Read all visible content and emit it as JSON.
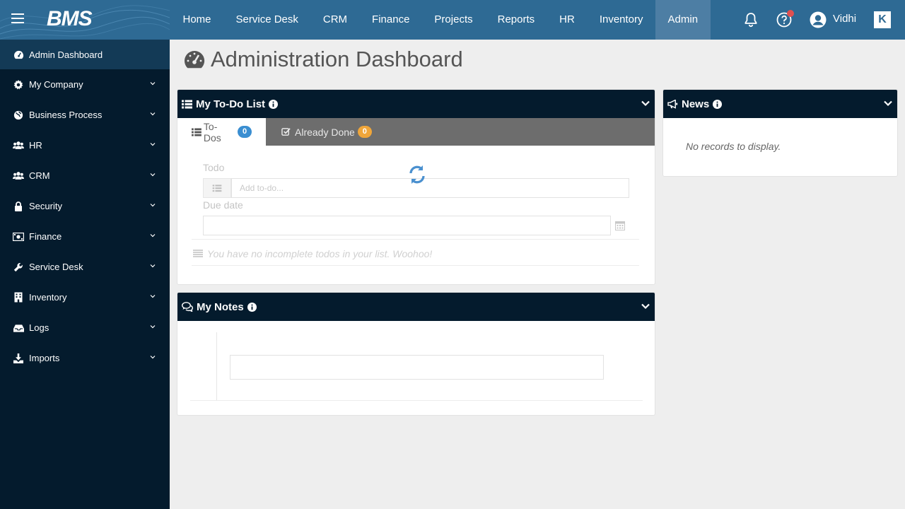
{
  "brand": {
    "logo_text": "BMS",
    "accent": "#2e6a94",
    "sidebar_bg": "#041b2d"
  },
  "topnav": {
    "items": [
      "Home",
      "Service Desk",
      "CRM",
      "Finance",
      "Projects",
      "Reports",
      "HR",
      "Inventory",
      "Admin"
    ],
    "active": "Admin",
    "user_name": "Vidhi",
    "notification_dot": true
  },
  "sidebar": {
    "items": [
      {
        "label": "Admin Dashboard",
        "icon": "dashboard-icon",
        "active": true,
        "expandable": false
      },
      {
        "label": "My Company",
        "icon": "gear-icon",
        "active": false,
        "expandable": true
      },
      {
        "label": "Business Process",
        "icon": "globe-icon",
        "active": false,
        "expandable": true
      },
      {
        "label": "HR",
        "icon": "users-icon",
        "active": false,
        "expandable": true
      },
      {
        "label": "CRM",
        "icon": "users-icon",
        "active": false,
        "expandable": true
      },
      {
        "label": "Security",
        "icon": "lock-icon",
        "active": false,
        "expandable": true
      },
      {
        "label": "Finance",
        "icon": "money-icon",
        "active": false,
        "expandable": true
      },
      {
        "label": "Service Desk",
        "icon": "wrench-icon",
        "active": false,
        "expandable": true
      },
      {
        "label": "Inventory",
        "icon": "building-icon",
        "active": false,
        "expandable": true
      },
      {
        "label": "Logs",
        "icon": "inbox-icon",
        "active": false,
        "expandable": true
      },
      {
        "label": "Imports",
        "icon": "download-icon",
        "active": false,
        "expandable": true
      }
    ]
  },
  "main": {
    "title": "Administration Dashboard",
    "todo": {
      "title": "My To-Do List",
      "tabs": [
        {
          "label": "To-Dos",
          "count": "0",
          "badge_color": "#3a8ed1"
        },
        {
          "label": "Already Done",
          "count": "0",
          "badge_color": "#f0a63a"
        }
      ],
      "todo_label": "Todo",
      "todo_placeholder": "Add to-do...",
      "due_label": "Due date",
      "due_value": "",
      "empty_message": "You have no incomplete todos in your list. Woohoo!"
    },
    "notes": {
      "title": "My Notes",
      "value": ""
    },
    "news": {
      "title": "News",
      "empty_message": "No records to display."
    }
  }
}
